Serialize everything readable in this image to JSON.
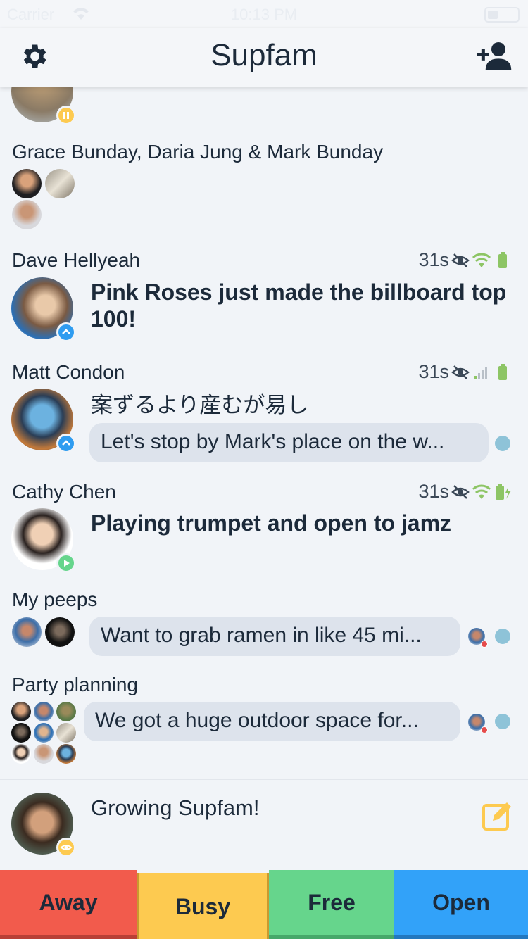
{
  "status_bar": {
    "carrier": "Carrier",
    "time": "10:13 PM"
  },
  "nav": {
    "title": "Supfam",
    "settings_icon": "gear-icon",
    "add_icon": "add-person-icon"
  },
  "feed": {
    "group1": {
      "name": "Grace Bunday, Daria Jung & Mark Bunday"
    },
    "dave": {
      "name": "Dave Hellyeah",
      "time": "31s",
      "status": "Pink Roses just made the billboard top 100!",
      "badge_color": "#2f9cf0"
    },
    "matt": {
      "name": "Matt Condon",
      "time": "31s",
      "status": "案ずるより産むが易し",
      "message": "Let's stop by Mark's place on the w...",
      "badge_color": "#2f9cf0"
    },
    "cathy": {
      "name": "Cathy Chen",
      "time": "31s",
      "status": "Playing trumpet and open to jamz",
      "badge_color": "#66d58c"
    },
    "peeps": {
      "name": "My peeps",
      "message": "Want to grab ramen in like 45 mi..."
    },
    "party": {
      "name": "Party planning",
      "message": "We got a huge outdoor space for..."
    }
  },
  "me": {
    "status": "Growing Supfam!",
    "badge_color": "#fdca50"
  },
  "bottom_bar": {
    "away": "Away",
    "busy": "Busy",
    "free": "Free",
    "open": "Open"
  },
  "colors": {
    "away": "#f25b4c",
    "busy": "#fdca50",
    "free": "#66d58c",
    "open": "#32a2f9",
    "unread_dot": "#8ec3d8"
  }
}
